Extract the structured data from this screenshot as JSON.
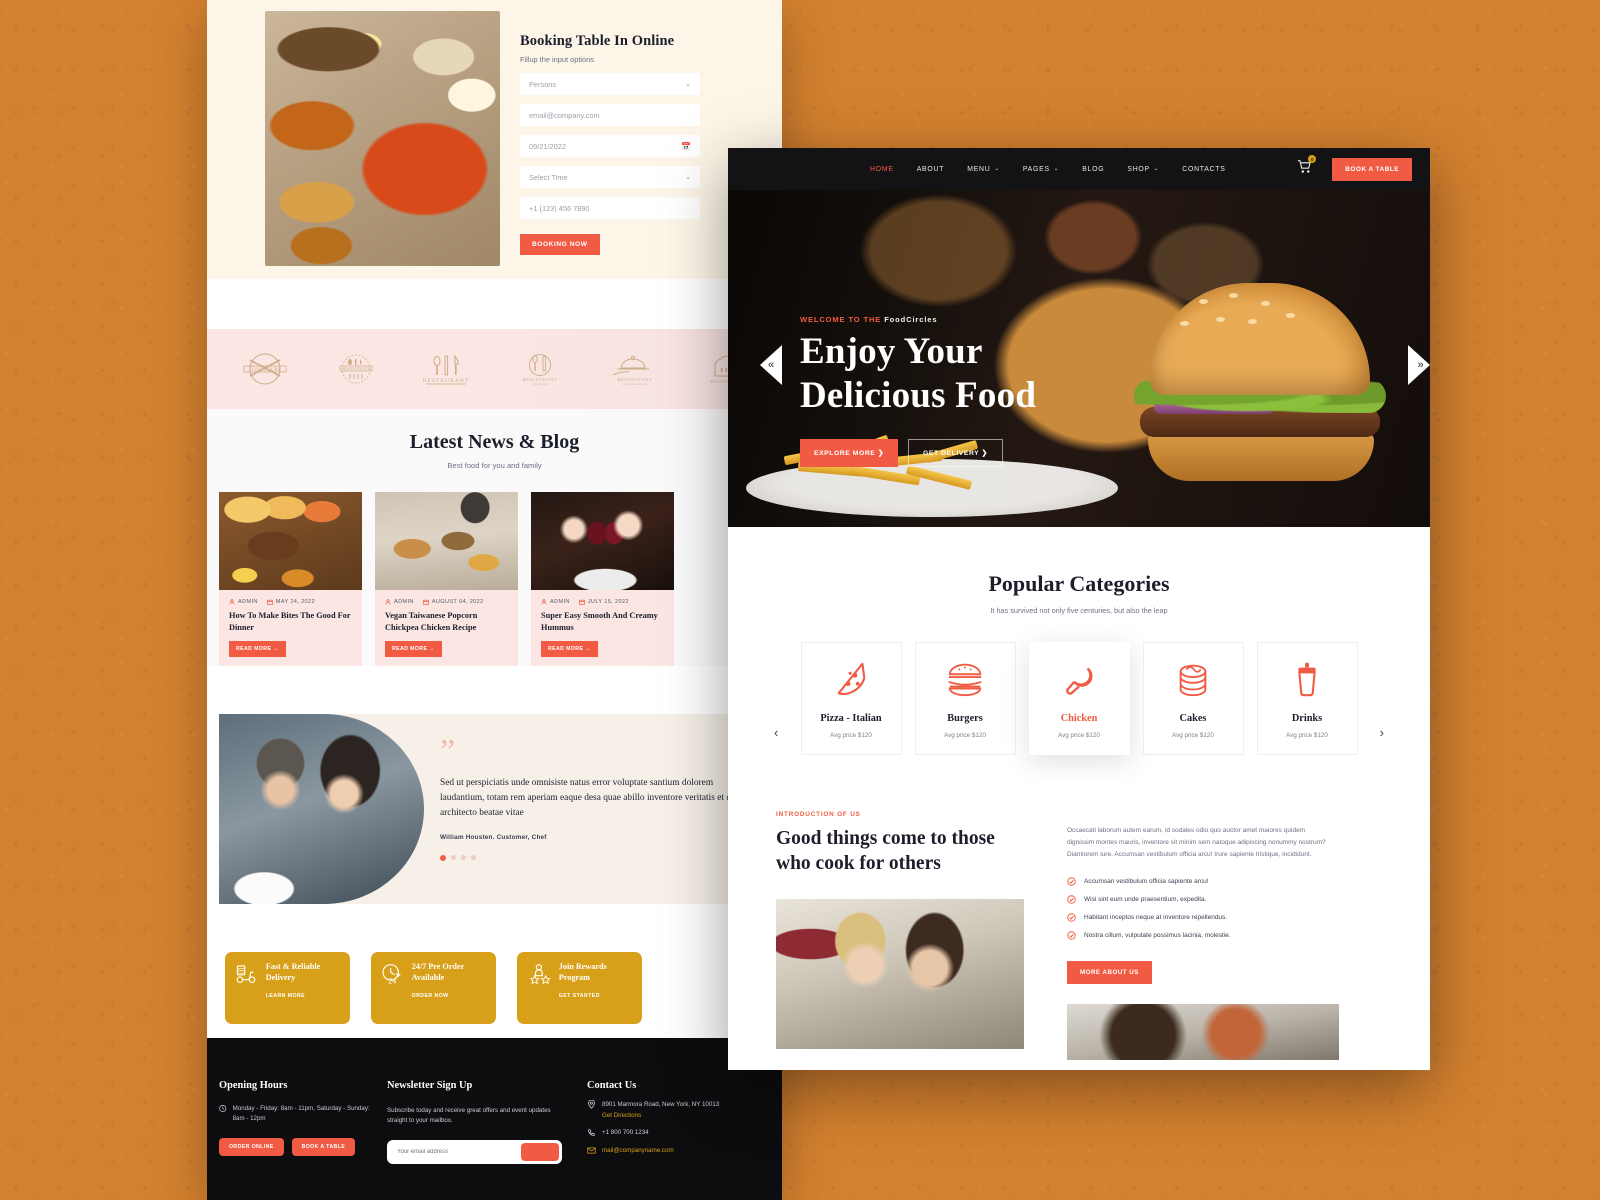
{
  "panel_a": {
    "booking": {
      "title": "Booking Table In Online",
      "subtitle": "Fillup the input options",
      "persons_value": "Persons",
      "email_value": "email@company.com",
      "date_value": "09/21/2022",
      "time_value": "Select Time",
      "phone_value": "+1 (123) 456 7890",
      "submit_label": "BOOKING NOW"
    },
    "brands": [
      "food-court-logo",
      "restaurant-badge-logo",
      "cutlery-restaurant-logo",
      "plate-restaurant-logo",
      "cloche-restaurant-logo",
      "chef-hat-restaurant-logo"
    ],
    "blog": {
      "title": "Latest News & Blog",
      "subtitle": "Best food for you and family",
      "posts": [
        {
          "author": "ADMIN",
          "date": "MAY 24, 2022",
          "title": "How To Make Bites The Good For Dinner",
          "cta": "READ MORE →"
        },
        {
          "author": "ADMIN",
          "date": "AUGUST 04, 2022",
          "title": "Vegan Taiwanese Popcorn Chickpea Chicken Recipe",
          "cta": "READ MORE →"
        },
        {
          "author": "ADMIN",
          "date": "JULY 15, 2022",
          "title": "Super Easy Smooth And Creamy Hummus",
          "cta": "READ MORE →"
        }
      ]
    },
    "testimonial": {
      "quote": "Sed ut perspiciatis unde omnisiste natus error voluptate santium dolorem laudantium, totam rem aperiam eaque desa quae abillo inventore veritatis et quasi architecto beatae vitae",
      "author": "William Housten. Customer, Chef"
    },
    "promos": [
      {
        "title": "Fast & Reliable Delivery",
        "link": "LEARN MORE",
        "icon": "scooter-delivery-icon"
      },
      {
        "title": "24/7 Pre Order Available",
        "link": "ORDER NOW",
        "icon": "clock-24-icon"
      },
      {
        "title": "Join Rewards Program",
        "link": "GET STARTED",
        "icon": "rewards-star-icon"
      }
    ],
    "footer": {
      "hours_title": "Opening Hours",
      "hours_text": "Monday - Friday: 8am - 11pm, Saturday - Sunday: 8am - 12pm",
      "hours_btn_1": "ORDER ONLINE",
      "hours_btn_2": "BOOK A TABLE",
      "newsletter_title": "Newsletter Sign Up",
      "newsletter_text": "Subscribe today and receive great offers and event updates straight to your mailbox.",
      "newsletter_placeholder": "Your email address",
      "contact_title": "Contact Us",
      "address": "8901 Marmora Road, New York, NY 10013",
      "directions": "Get Directions",
      "phone": "+1 800 700 1234",
      "email": "mail@companyname.com"
    },
    "prev_arrow": "«"
  },
  "panel_b": {
    "nav": {
      "logo": "foodcircles-logo",
      "items": [
        {
          "label": "HOME",
          "caret": "",
          "active": true
        },
        {
          "label": "ABOUT",
          "caret": "",
          "active": false
        },
        {
          "label": "MENU",
          "caret": "⌄",
          "active": false
        },
        {
          "label": "PAGES",
          "caret": "⌄",
          "active": false
        },
        {
          "label": "BLOG",
          "caret": "",
          "active": false
        },
        {
          "label": "SHOP",
          "caret": "⌄",
          "active": false
        },
        {
          "label": "CONTACTS",
          "caret": "",
          "active": false
        }
      ],
      "cart_count": "0",
      "book_label": "BOOK A TABLE"
    },
    "hero": {
      "kicker_pre": "WELCOME TO THE ",
      "kicker_brand": "FoodCircles",
      "line1": "Enjoy Your",
      "line2": "Delicious Food",
      "btn_primary": "EXPLORE MORE  ❯",
      "btn_secondary": "GET DELIVERY  ❯",
      "next_arrow": "»"
    },
    "categories": {
      "title": "Popular Categories",
      "subtitle": "It has survived not only five centuries, but also the leap",
      "prev": "‹",
      "next": "›",
      "items": [
        {
          "name": "Pizza - Italian",
          "price": "Avg price $120",
          "icon": "pizza-slice-icon",
          "selected": false
        },
        {
          "name": "Burgers",
          "price": "Avg price $120",
          "icon": "burger-icon",
          "selected": false
        },
        {
          "name": "Chicken",
          "price": "Avg price $120",
          "icon": "chicken-leg-icon",
          "selected": true
        },
        {
          "name": "Cakes",
          "price": "Avg price $120",
          "icon": "cake-icon",
          "selected": false
        },
        {
          "name": "Drinks",
          "price": "Avg price $120",
          "icon": "drink-cup-icon",
          "selected": false
        }
      ]
    },
    "intro": {
      "kicker": "INTRODUCTION OF US",
      "heading": "Good things come to those who cook for others",
      "paragraph": "Occaecati laborum autem earum, id sodales odio quo auctor amet maiores quidem dignissim montes mauris, inventore sit minim sem natoque adipiscing nonummy nostrum? Diamlorem iure. Accumsan vestibulum officia arcu! Irure sapiente tristique, incididunt.",
      "bullets": [
        "Accumsan vestibulum officia sapiente arcu!",
        "Wisi sint eum unde praesentium, expedita.",
        "Habitant inceptos neque at inventore repellendus.",
        "Nostra cillum, vulputate possimus lacinia, molestie."
      ],
      "cta": "MORE ABOUT US"
    }
  },
  "colors": {
    "accent": "#f15b43",
    "gold": "#d8a018",
    "dark": "#131316",
    "backdrop": "#d4812f",
    "cream": "#fdf6e8",
    "blush": "#fbe6e4"
  }
}
